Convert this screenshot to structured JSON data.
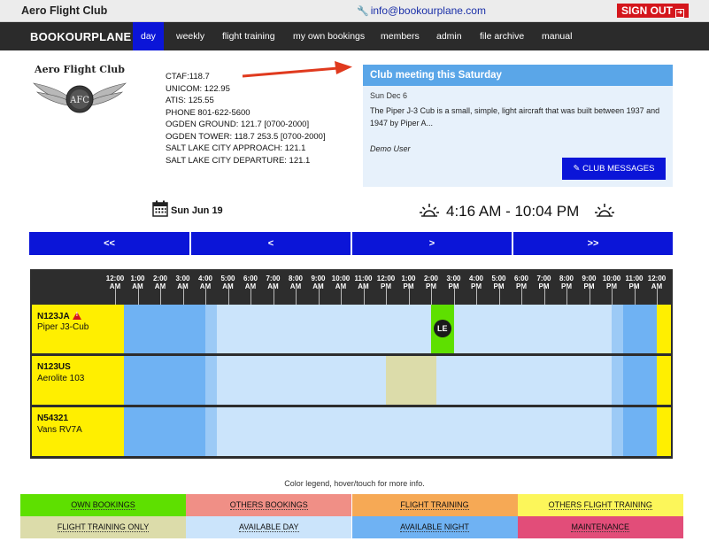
{
  "header": {
    "club_name": "Aero Flight Club",
    "email": "info@bookourplane.com",
    "signout_label": "SIGN OUT"
  },
  "nav": {
    "brand": "BOOKOURPLANE",
    "items": [
      {
        "label": "day",
        "active": true
      },
      {
        "label": "weekly"
      },
      {
        "label": "flight training"
      },
      {
        "label": "my own bookings"
      },
      {
        "label": "members"
      },
      {
        "label": "admin"
      },
      {
        "label": "file archive"
      },
      {
        "label": "manual"
      }
    ]
  },
  "logo": {
    "text": "Aero Flight Club",
    "badge": "AFC"
  },
  "frequencies": [
    "CTAF:118.7",
    "UNICOM: 122.95",
    "ATIS: 125.55",
    "PHONE 801-622-5600",
    "OGDEN GROUND: 121.7 [0700-2000]",
    "OGDEN TOWER: 118.7 253.5 [0700-2000]",
    "SALT LAKE CITY APPROACH: 121.1",
    "SALT LAKE CITY DEPARTURE: 121.1"
  ],
  "message": {
    "title": "Club meeting this Saturday",
    "date": "Sun Dec 6",
    "body": "The Piper J-3 Cub is a small, simple, light aircraft that was built between 1937 and 1947 by Piper A...",
    "author": "Demo User",
    "button_label": "CLUB MESSAGES"
  },
  "day": {
    "date": "Sun Jun 19",
    "sun_times": "4:16 AM - 10:04 PM"
  },
  "pager": [
    "<<",
    "<",
    ">",
    ">>"
  ],
  "schedule": {
    "hours": [
      [
        "12:00",
        "AM"
      ],
      [
        "1:00",
        "AM"
      ],
      [
        "2:00",
        "AM"
      ],
      [
        "3:00",
        "AM"
      ],
      [
        "4:00",
        "AM"
      ],
      [
        "5:00",
        "AM"
      ],
      [
        "6:00",
        "AM"
      ],
      [
        "7:00",
        "AM"
      ],
      [
        "8:00",
        "AM"
      ],
      [
        "9:00",
        "AM"
      ],
      [
        "10:00",
        "AM"
      ],
      [
        "11:00",
        "AM"
      ],
      [
        "12:00",
        "PM"
      ],
      [
        "1:00",
        "PM"
      ],
      [
        "2:00",
        "PM"
      ],
      [
        "3:00",
        "PM"
      ],
      [
        "4:00",
        "PM"
      ],
      [
        "5:00",
        "PM"
      ],
      [
        "6:00",
        "PM"
      ],
      [
        "7:00",
        "PM"
      ],
      [
        "8:00",
        "PM"
      ],
      [
        "9:00",
        "PM"
      ],
      [
        "10:00",
        "PM"
      ],
      [
        "11:00",
        "PM"
      ],
      [
        "12:00",
        "AM"
      ]
    ],
    "aircraft": [
      {
        "reg": "N123JA",
        "model": "Piper J3-Cub",
        "warning": true,
        "booking": {
          "type": "own",
          "start": 14.0,
          "end": 15.0,
          "initials": "LE"
        }
      },
      {
        "reg": "N123US",
        "model": "Aerolite 103",
        "warning": false,
        "booking": {
          "type": "training_only",
          "start": 12.0,
          "end": 14.25
        }
      },
      {
        "reg": "N54321",
        "model": "Vans RV7A",
        "warning": false,
        "booking": null
      }
    ],
    "night_end": 4.0,
    "dawn_end": 4.5,
    "day_end": 22.0,
    "dusk_end": 22.5,
    "colors": {
      "night": "#6fb2f3",
      "dawn": "#9ccaf6",
      "day": "#cbe4fb",
      "own": "#5ee000",
      "training_only": "#dcdcaa",
      "end_cap": "#ffef00"
    }
  },
  "legend": {
    "title": "Color legend, hover/touch for more info.",
    "items": [
      {
        "label": "OWN BOOKINGS",
        "color": "#5ee000"
      },
      {
        "label": "OTHERS BOOKINGS",
        "color": "#f08f86"
      },
      {
        "label": "FLIGHT TRAINING",
        "color": "#f6a955"
      },
      {
        "label": "OTHERS FLIGHT TRAINING",
        "color": "#fcf65a"
      },
      {
        "label": "FLIGHT TRAINING ONLY",
        "color": "#dcdcaa"
      },
      {
        "label": "AVAILABLE DAY",
        "color": "#cbe4fb"
      },
      {
        "label": "AVAILABLE NIGHT",
        "color": "#6fb2f3"
      },
      {
        "label": "MAINTENANCE",
        "color": "#e24d79"
      }
    ]
  }
}
